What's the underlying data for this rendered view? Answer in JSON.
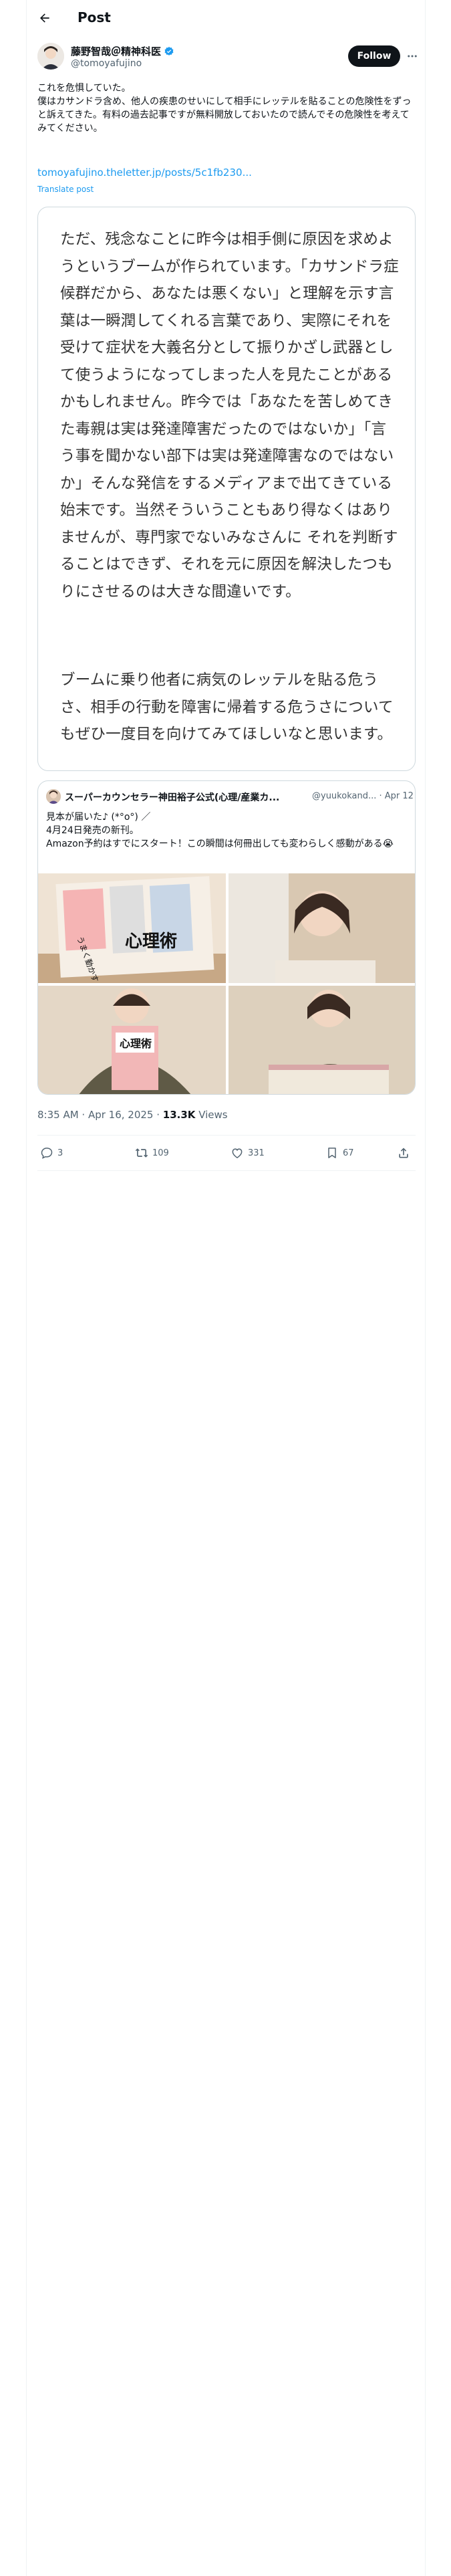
{
  "header": {
    "title": "Post"
  },
  "author": {
    "name": "藤野智哉＠精神科医",
    "handle": "@tomoyafujino",
    "follow_label": "Follow"
  },
  "post": {
    "lines": [
      "これを危惧していた。",
      "僕はカサンドラ含め、他人の疾患のせいにして相手にレッテルを貼ることの危険性をずっと訴えてきた。有料の過去記事ですが無料開放しておいたので読んでその危険性を考えてみてください。"
    ],
    "link": "tomoyafujino.theletter.jp/posts/5c1fb230...",
    "translate": "Translate post"
  },
  "image_card": {
    "paragraph1": "ただ、残念なことに昨今は相手側に原因を求めようというブームが作られています。「カサンドラ症候群だから、あなたは悪くない」と理解を示す言葉は一瞬潤してくれる言葉であり、実際にそれを受けて症状を大義名分として振りかざし武器として使うようになってしまった人を見たことがあるかもしれません。昨今では「あなたを苦しめてきた毒親は実は発達障害だったのではないか」「言う事を聞かない部下は実は発達障害なのではないか」そんな発信をするメディアまで出てきている始末です。当然そういうこともあり得なくはありませんが、専門家でないみなさんに それを判断することはできず、それを元に原因を解決したつもりにさせるのは大きな間違いです。",
    "paragraph2": "ブームに乗り他者に病気のレッテルを貼る危うさ、相手の行動を障害に帰着する危うさについてもぜひ一度目を向けてみてほしいなと思います。"
  },
  "quote": {
    "name": "スーパーカウンセラー神田裕子公式(心理/産業カ...",
    "handle": "@yuukokand... · Apr 12",
    "lines": [
      "見本が届いた♪ (*°o°) ／",
      "4月24日発売の新刊。",
      "Amazon予約はすでにスタート！この瞬間は何冊出しても変わらしく感動がある😭"
    ],
    "book_title": "心理術",
    "book_sub": "うまく動かす"
  },
  "meta": {
    "time": "8:35 AM · Apr 16, 2025 · ",
    "views_count": "13.3K",
    "views_label": " Views"
  },
  "actions": {
    "replies": "3",
    "reposts": "109",
    "likes": "331",
    "bookmarks": "67"
  },
  "colors": {
    "accent": "#1d9bf0",
    "text": "#0f1419",
    "muted": "#536471",
    "border": "#cfd9de",
    "verified": "#1d9bf0"
  }
}
